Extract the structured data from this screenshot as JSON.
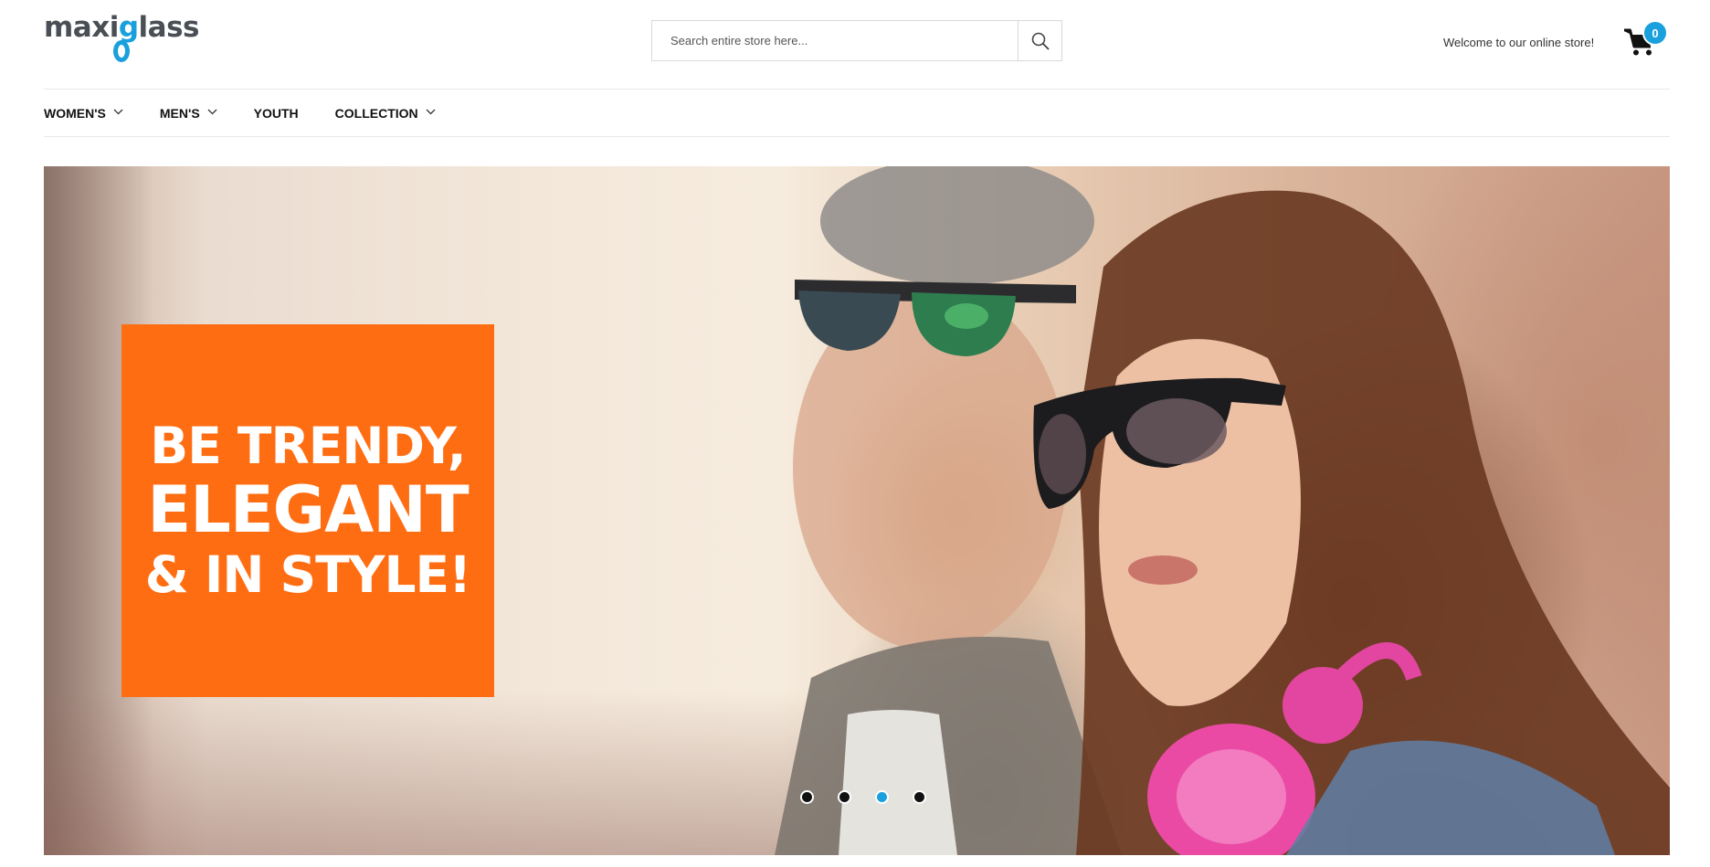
{
  "brand": {
    "logo_text_before": "maxi",
    "logo_text_after": "lass",
    "logo_letter": "g"
  },
  "search": {
    "placeholder": "Search entire store here..."
  },
  "header": {
    "welcome_text": "Welcome to our online store!",
    "cart_count": "0"
  },
  "nav": {
    "items": [
      {
        "label": "Women's",
        "has_dropdown": true
      },
      {
        "label": "Men's",
        "has_dropdown": true
      },
      {
        "label": "Youth",
        "has_dropdown": false
      },
      {
        "label": "Collection",
        "has_dropdown": true
      }
    ]
  },
  "hero": {
    "line1": "BE TRENDY,",
    "line2": "ELEGANT",
    "line3": "& IN STYLE!",
    "slides_total": 4,
    "active_slide": 3
  },
  "colors": {
    "accent": "#1aa0dc",
    "promo": "#ff6d12"
  },
  "icons": [
    "search-icon",
    "cart-icon",
    "chevron-down-icon"
  ]
}
